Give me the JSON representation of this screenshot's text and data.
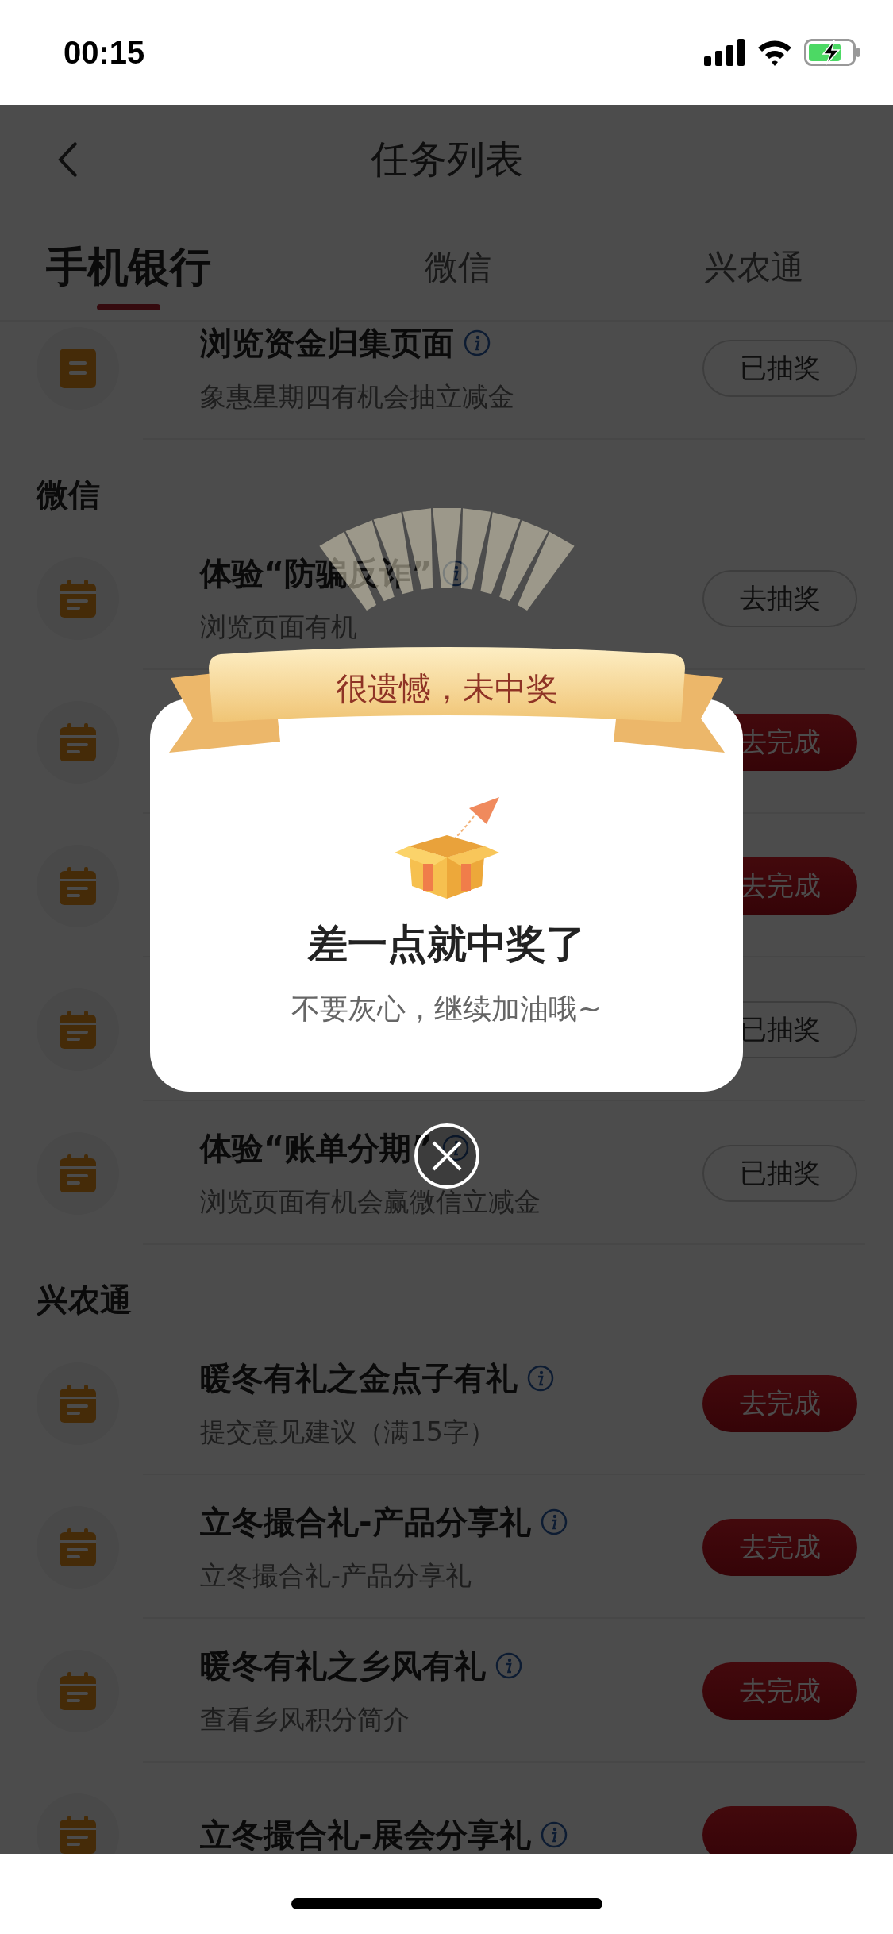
{
  "status": {
    "time": "00:15"
  },
  "header": {
    "title": "任务列表"
  },
  "tabs": [
    {
      "label": "手机银行",
      "selected": true
    },
    {
      "label": "微信",
      "selected": false
    },
    {
      "label": "兴农通",
      "selected": false
    }
  ],
  "sections": [
    {
      "tasks": [
        {
          "kind": "document",
          "title": "浏览资金归集页面",
          "info": true,
          "subtitle": "象惠星期四有机会抽立减金",
          "button": {
            "label": "已抽奖",
            "kind": "outline"
          }
        }
      ]
    },
    {
      "heading": "微信",
      "tasks": [
        {
          "kind": "calendar",
          "title": "体验“防骗反诈”",
          "info": true,
          "subtitle": "浏览页面有机",
          "button": {
            "label": "去抽奖",
            "kind": "outline"
          }
        },
        {
          "kind": "calendar",
          "button": {
            "label": "去完成",
            "kind": "filled"
          }
        },
        {
          "kind": "calendar",
          "button": {
            "label": "去完成",
            "kind": "filled"
          }
        },
        {
          "kind": "calendar",
          "button": {
            "label": "已抽奖",
            "kind": "outline"
          }
        },
        {
          "kind": "calendar",
          "title": "体验“账单分期”",
          "info": true,
          "subtitle": "浏览页面有机会赢微信立减金",
          "button": {
            "label": "已抽奖",
            "kind": "outline"
          }
        }
      ]
    },
    {
      "heading": "兴农通",
      "tasks": [
        {
          "kind": "calendar",
          "title": "暖冬有礼之金点子有礼",
          "info": true,
          "subtitle": "提交意见建议（满15字）",
          "button": {
            "label": "去完成",
            "kind": "filled"
          }
        },
        {
          "kind": "calendar",
          "title": "立冬撮合礼-产品分享礼",
          "info": true,
          "subtitle": "立冬撮合礼-产品分享礼",
          "button": {
            "label": "去完成",
            "kind": "filled"
          }
        },
        {
          "kind": "calendar",
          "title": "暖冬有礼之乡风有礼",
          "info": true,
          "subtitle": "查看乡风积分简介",
          "button": {
            "label": "去完成",
            "kind": "filled"
          }
        },
        {
          "kind": "calendar",
          "title": "立冬撮合礼-展会分享礼",
          "info": true,
          "button": {
            "kind": "filled"
          }
        }
      ]
    }
  ],
  "modal": {
    "banner": "很遗憾，未中奖",
    "title": "差一点就中奖了",
    "message": "不要灰心，继续加油哦~"
  }
}
